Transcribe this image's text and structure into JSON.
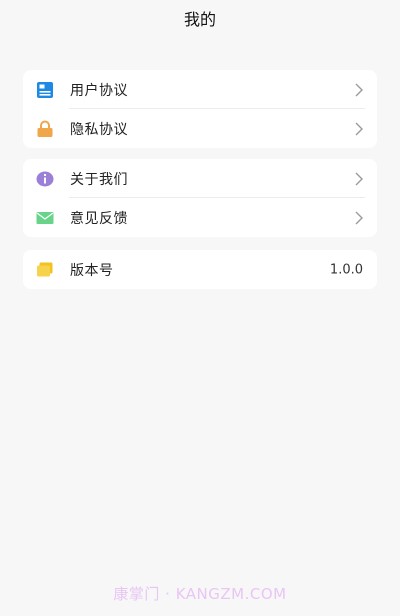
{
  "header": {
    "title": "我的"
  },
  "sections": [
    {
      "items": [
        {
          "label": "用户协议",
          "icon": "document-icon",
          "color": "#1e88e5"
        },
        {
          "label": "隐私协议",
          "icon": "lock-icon",
          "color": "#f0a64a"
        }
      ]
    },
    {
      "items": [
        {
          "label": "关于我们",
          "icon": "info-icon",
          "color": "#9b7fd9"
        },
        {
          "label": "意见反馈",
          "icon": "mail-icon",
          "color": "#67d48a"
        }
      ]
    },
    {
      "items": [
        {
          "label": "版本号",
          "icon": "folder-icon",
          "color": "#f6d34a",
          "value": "1.0.0"
        }
      ]
    }
  ],
  "watermark": "康掌门 · KANGZM.COM"
}
